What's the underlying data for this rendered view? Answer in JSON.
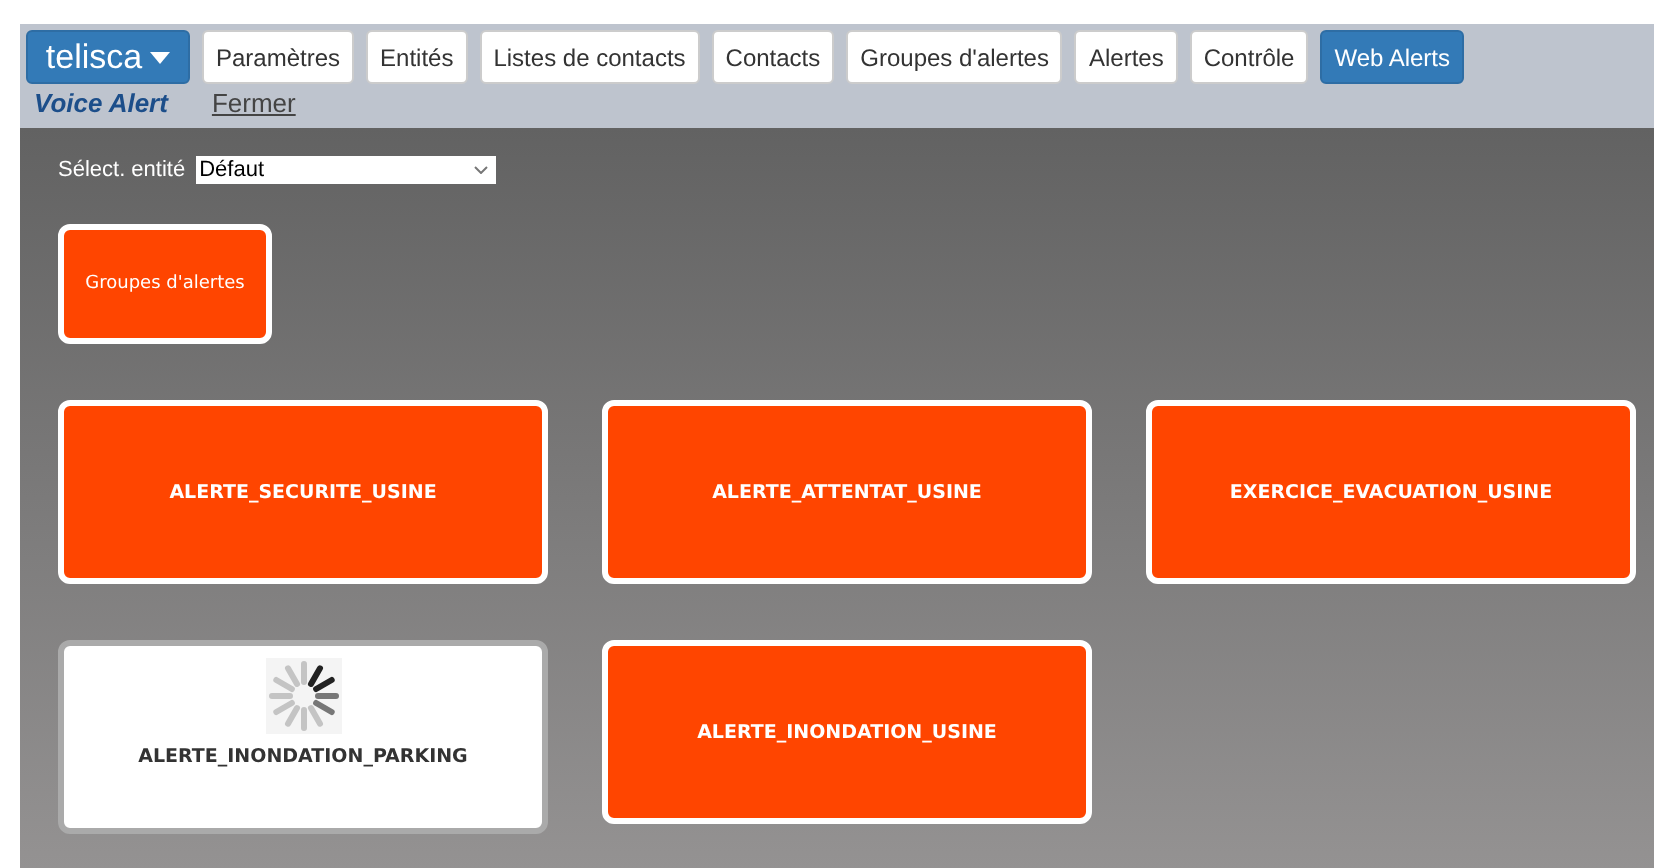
{
  "brand": {
    "label": "telisca"
  },
  "tabs": [
    {
      "label": "Paramètres",
      "selected": false
    },
    {
      "label": "Entités",
      "selected": false
    },
    {
      "label": "Listes de contacts",
      "selected": false
    },
    {
      "label": "Contacts",
      "selected": false
    },
    {
      "label": "Groupes d'alertes",
      "selected": false
    },
    {
      "label": "Alertes",
      "selected": false
    },
    {
      "label": "Contrôle",
      "selected": false
    },
    {
      "label": "Web Alerts",
      "selected": true
    }
  ],
  "subnav": {
    "title": "Voice Alert",
    "link": "Fermer"
  },
  "entity_select": {
    "label": "Sélect. entité",
    "value": "Défaut"
  },
  "groups_button": {
    "label": "Groupes d'alertes"
  },
  "alerts": [
    {
      "label": "ALERTE_SECURITE_USINE",
      "loading": false
    },
    {
      "label": "ALERTE_ATTENTAT_USINE",
      "loading": false
    },
    {
      "label": "EXERCICE_EVACUATION_USINE",
      "loading": false
    },
    {
      "label": "ALERTE_INONDATION_PARKING",
      "loading": true
    },
    {
      "label": "ALERTE_INONDATION_USINE",
      "loading": false
    }
  ]
}
